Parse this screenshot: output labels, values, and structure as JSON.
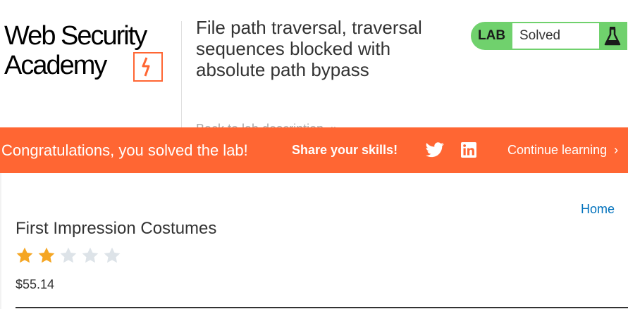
{
  "logo": {
    "line1": "Web Security",
    "line2": "Academy"
  },
  "lab": {
    "title": "File path traversal, traversal sequences blocked with absolute path bypass",
    "back_link": "Back to lab description",
    "status_label": "LAB",
    "status_value": "Solved"
  },
  "banner": {
    "congrats": "Congratulations, you solved the lab!",
    "share": "Share your skills!",
    "continue": "Continue learning"
  },
  "nav": {
    "home": "Home"
  },
  "product": {
    "title": "First Impression Costumes",
    "rating": 2,
    "rating_max": 5,
    "price": "$55.14"
  },
  "colors": {
    "brand_orange": "#ff6633",
    "lab_green": "#70d16d",
    "link_blue": "#0071bc",
    "star_filled": "#f5a623",
    "star_empty": "#dde3e8"
  }
}
